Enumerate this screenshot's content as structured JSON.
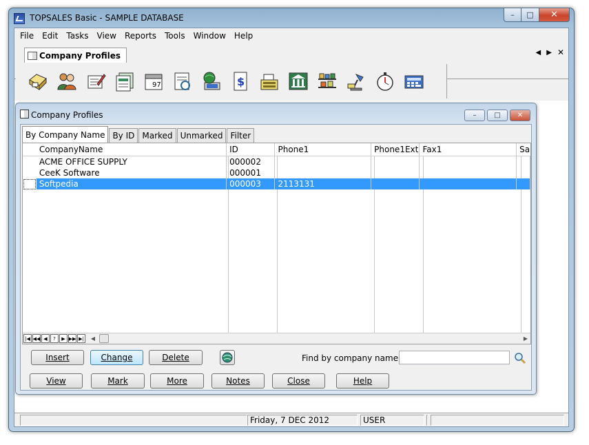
{
  "window": {
    "title": "TOPSALES Basic - SAMPLE DATABASE",
    "controls": {
      "minimize": "–",
      "maximize": "□",
      "close": "✕"
    }
  },
  "menu": [
    "File",
    "Edit",
    "Tasks",
    "View",
    "Reports",
    "Tools",
    "Window",
    "Help"
  ],
  "doc_tab": {
    "label": "Company Profiles",
    "nav": {
      "prev": "◀",
      "next": "▶",
      "close": "✕"
    }
  },
  "toolbar": [
    {
      "icon": "company-profiles-icon"
    },
    {
      "icon": "contacts-icon"
    },
    {
      "icon": "edit-document-icon"
    },
    {
      "icon": "letters-icon"
    },
    {
      "icon": "calendar-icon"
    },
    {
      "icon": "notes-icon"
    },
    {
      "icon": "internet-icon"
    },
    {
      "icon": "invoice-dollar-icon"
    },
    {
      "icon": "cash-register-icon"
    },
    {
      "icon": "bank-icon"
    },
    {
      "icon": "products-icon"
    },
    {
      "icon": "desk-lamp-icon"
    },
    {
      "icon": "stopwatch-icon"
    },
    {
      "icon": "calculator-icon"
    }
  ],
  "child_window": {
    "title": "Company Profiles",
    "controls": {
      "minimize": "–",
      "maximize": "□",
      "close": "✕"
    }
  },
  "tabs": [
    "By Company Name",
    "By ID",
    "Marked",
    "Unmarked",
    "Filter"
  ],
  "grid": {
    "columns": [
      "CompanyName",
      "ID",
      "Phone1",
      "Phone1Ext",
      "Fax1",
      "Sa"
    ],
    "rows": [
      {
        "name": "ACME OFFICE SUPPLY",
        "id": "000002",
        "phone": "",
        "ext": "",
        "fax": "",
        "sa": "",
        "selected": false
      },
      {
        "name": "CeeK Software",
        "id": "000001",
        "phone": "",
        "ext": "",
        "fax": "",
        "sa": "",
        "selected": false
      },
      {
        "name": "Softpedia",
        "id": "000003",
        "phone": "2113131",
        "ext": "",
        "fax": "",
        "sa": "",
        "selected": true
      }
    ],
    "navigator": {
      "first": "|◀",
      "prev_page": "◀◀",
      "prev": "◀",
      "help": "?",
      "next": "▶",
      "next_page": "▶▶",
      "last": "▶|"
    },
    "scroll": {
      "left": "◀",
      "right": "▶"
    }
  },
  "buttons_row1": {
    "insert": "Insert",
    "change": "Change",
    "delete": "Delete"
  },
  "find": {
    "label": "Find by company name:",
    "value": "",
    "placeholder": ""
  },
  "buttons_row2": {
    "view": "View",
    "mark": "Mark",
    "more": "More",
    "notes": "Notes",
    "close": "Close",
    "help": "Help"
  },
  "status": {
    "cell1": "",
    "date": "Friday,  7 DEC 2012",
    "user": "USER",
    "cell4": "",
    "cell5": ""
  },
  "colors": {
    "selection": "#3399ff",
    "window_frame": "#a8c4dd",
    "panel": "#f0f0f0"
  }
}
